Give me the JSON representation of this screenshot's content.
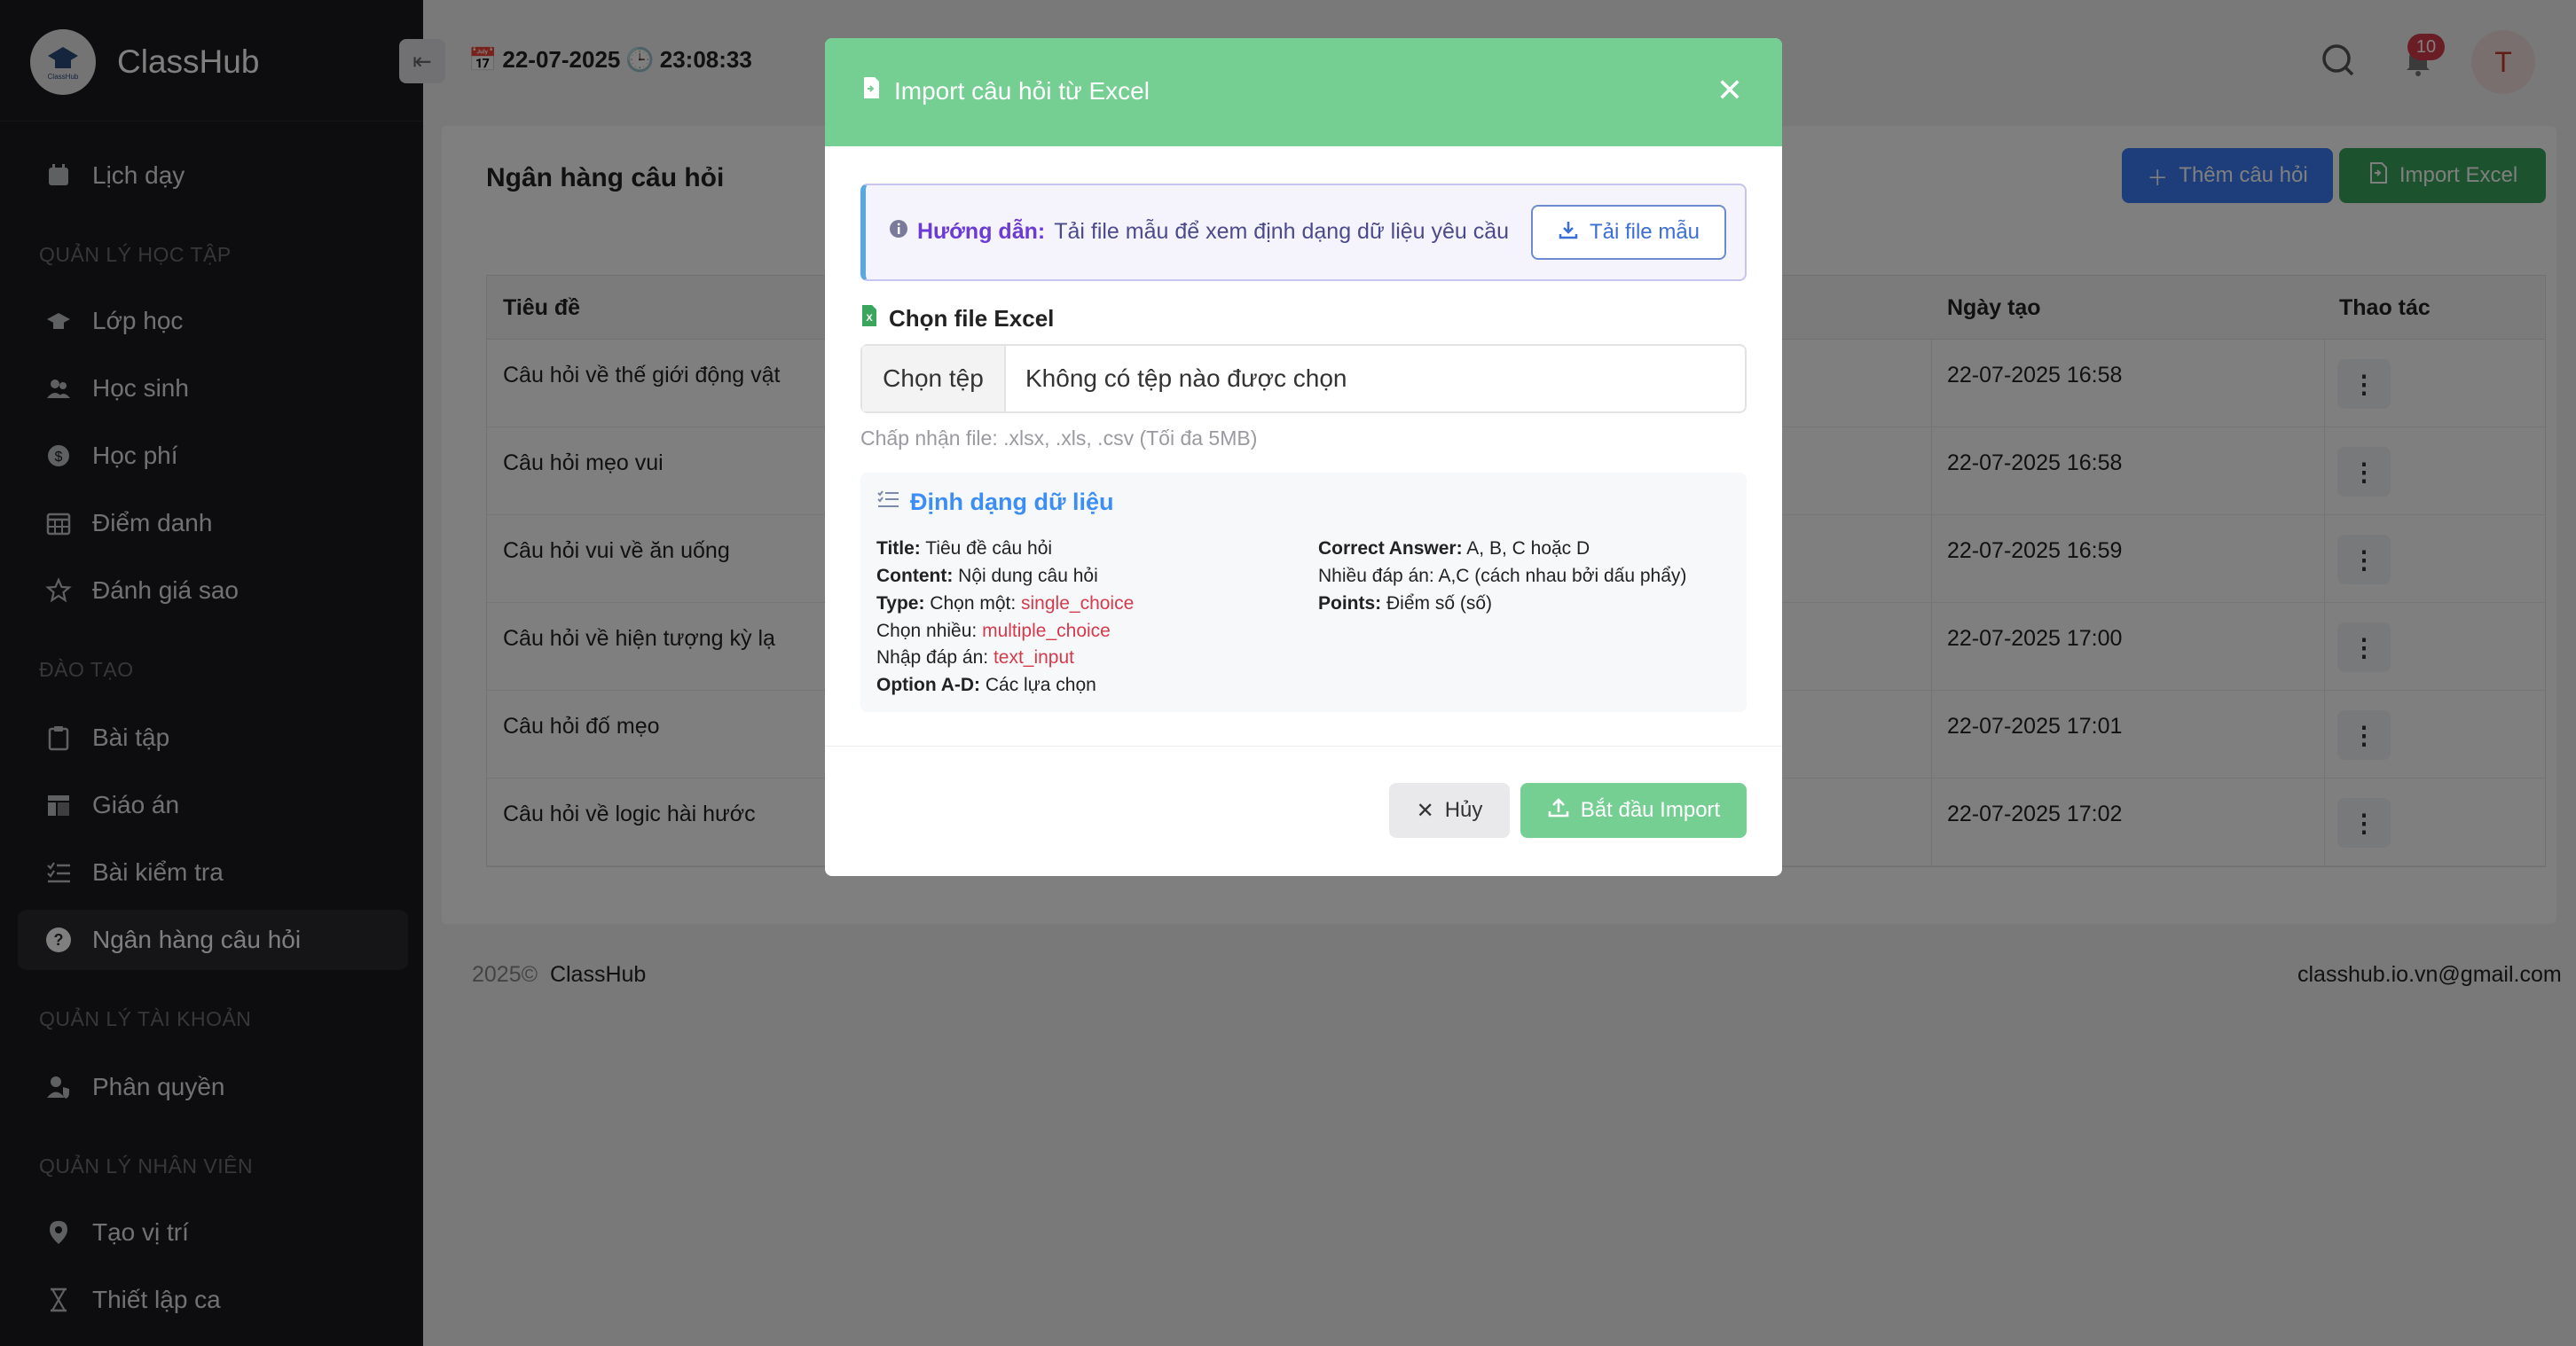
{
  "app": {
    "brand": "ClassHub",
    "logo_text": "ClassHub"
  },
  "sidebar": {
    "sections": [
      "QUẢN LÝ HỌC TẬP",
      "ĐÀO TẠO",
      "QUẢN LÝ TÀI KHOẢN",
      "QUẢN LÝ NHÂN VIÊN"
    ],
    "items": [
      {
        "label": "Lịch dạy",
        "icon": "calendar-icon"
      },
      {
        "label": "Lớp học",
        "icon": "graduation-cap-icon"
      },
      {
        "label": "Học sinh",
        "icon": "users-icon"
      },
      {
        "label": "Học phí",
        "icon": "dollar-icon"
      },
      {
        "label": "Điểm danh",
        "icon": "calendar-grid-icon"
      },
      {
        "label": "Đánh giá sao",
        "icon": "star-icon"
      },
      {
        "label": "Bài tập",
        "icon": "clipboard-icon"
      },
      {
        "label": "Giáo án",
        "icon": "layout-icon"
      },
      {
        "label": "Bài kiểm tra",
        "icon": "checklist-icon"
      },
      {
        "label": "Ngân hàng câu hỏi",
        "icon": "question-icon",
        "active": true
      },
      {
        "label": "Phân quyền",
        "icon": "user-shield-icon"
      },
      {
        "label": "Tạo vị trí",
        "icon": "location-icon"
      },
      {
        "label": "Thiết lập ca",
        "icon": "hourglass-icon"
      }
    ]
  },
  "topbar": {
    "date": "22-07-2025",
    "time": "23:08:33",
    "notifications": "10",
    "avatar_letter": "T"
  },
  "main": {
    "title": "Ngân hàng câu hỏi",
    "add_button": "Thêm câu hỏi",
    "import_button": "Import Excel",
    "columns": [
      "Tiêu đề",
      "Ngày tạo",
      "Thao tác"
    ],
    "rows": [
      {
        "title": "Câu hỏi về thế giới động vật",
        "date": "22-07-2025 16:58"
      },
      {
        "title": "Câu hỏi mẹo vui",
        "date": "22-07-2025 16:58"
      },
      {
        "title": "Câu hỏi vui về ăn uống",
        "date": "22-07-2025 16:59"
      },
      {
        "title": "Câu hỏi về hiện tượng kỳ lạ",
        "date": "22-07-2025 17:00"
      },
      {
        "title": "Câu hỏi đố mẹo",
        "date": "22-07-2025 17:01"
      },
      {
        "title": "Câu hỏi về logic hài hước",
        "date": "22-07-2025 17:02"
      }
    ]
  },
  "footer": {
    "year": "2025©",
    "brand": "ClassHub",
    "email": "classhub.io.vn@gmail.com"
  },
  "modal": {
    "title": "Import câu hỏi từ Excel",
    "guide_bold": "Hướng dẫn:",
    "guide_text": "Tải file mẫu để xem định dạng dữ liệu yêu cầu",
    "template_button": "Tải file mẫu",
    "file_label": "Chọn file Excel",
    "file_button": "Chọn tệp",
    "file_none": "Không có tệp nào được chọn",
    "accept_text": "Chấp nhận file: .xlsx, .xls, .csv (Tối đa 5MB)",
    "format_title": "Định dạng dữ liệu",
    "format_left": [
      {
        "key": "Title:",
        "value": "Tiêu đề câu hỏi"
      },
      {
        "key": "Content:",
        "value": "Nội dung câu hỏi"
      },
      {
        "key": "Type:",
        "value": "Chọn một: ",
        "code": "single_choice"
      },
      {
        "key": "",
        "value": "Chọn nhiều: ",
        "code": "multiple_choice"
      },
      {
        "key": "",
        "value": "Nhập đáp án: ",
        "code": "text_input"
      },
      {
        "key": "Option A-D:",
        "value": "Các lựa chọn"
      }
    ],
    "format_right": [
      {
        "key": "Correct Answer:",
        "value": "A, B, C hoặc D"
      },
      {
        "key": "",
        "value": "Nhiều đáp án: A,C (cách nhau bởi dấu phẩy)"
      },
      {
        "key": "Points:",
        "value": "Điểm số (số)"
      }
    ],
    "cancel_button": "Hủy",
    "start_button": "Bắt đầu Import"
  },
  "colors": {
    "accent_green": "#75ce92",
    "primary_blue": "#3b7cf5",
    "sidebar_bg": "#1a1b1e",
    "badge_red": "#d63a4a"
  }
}
